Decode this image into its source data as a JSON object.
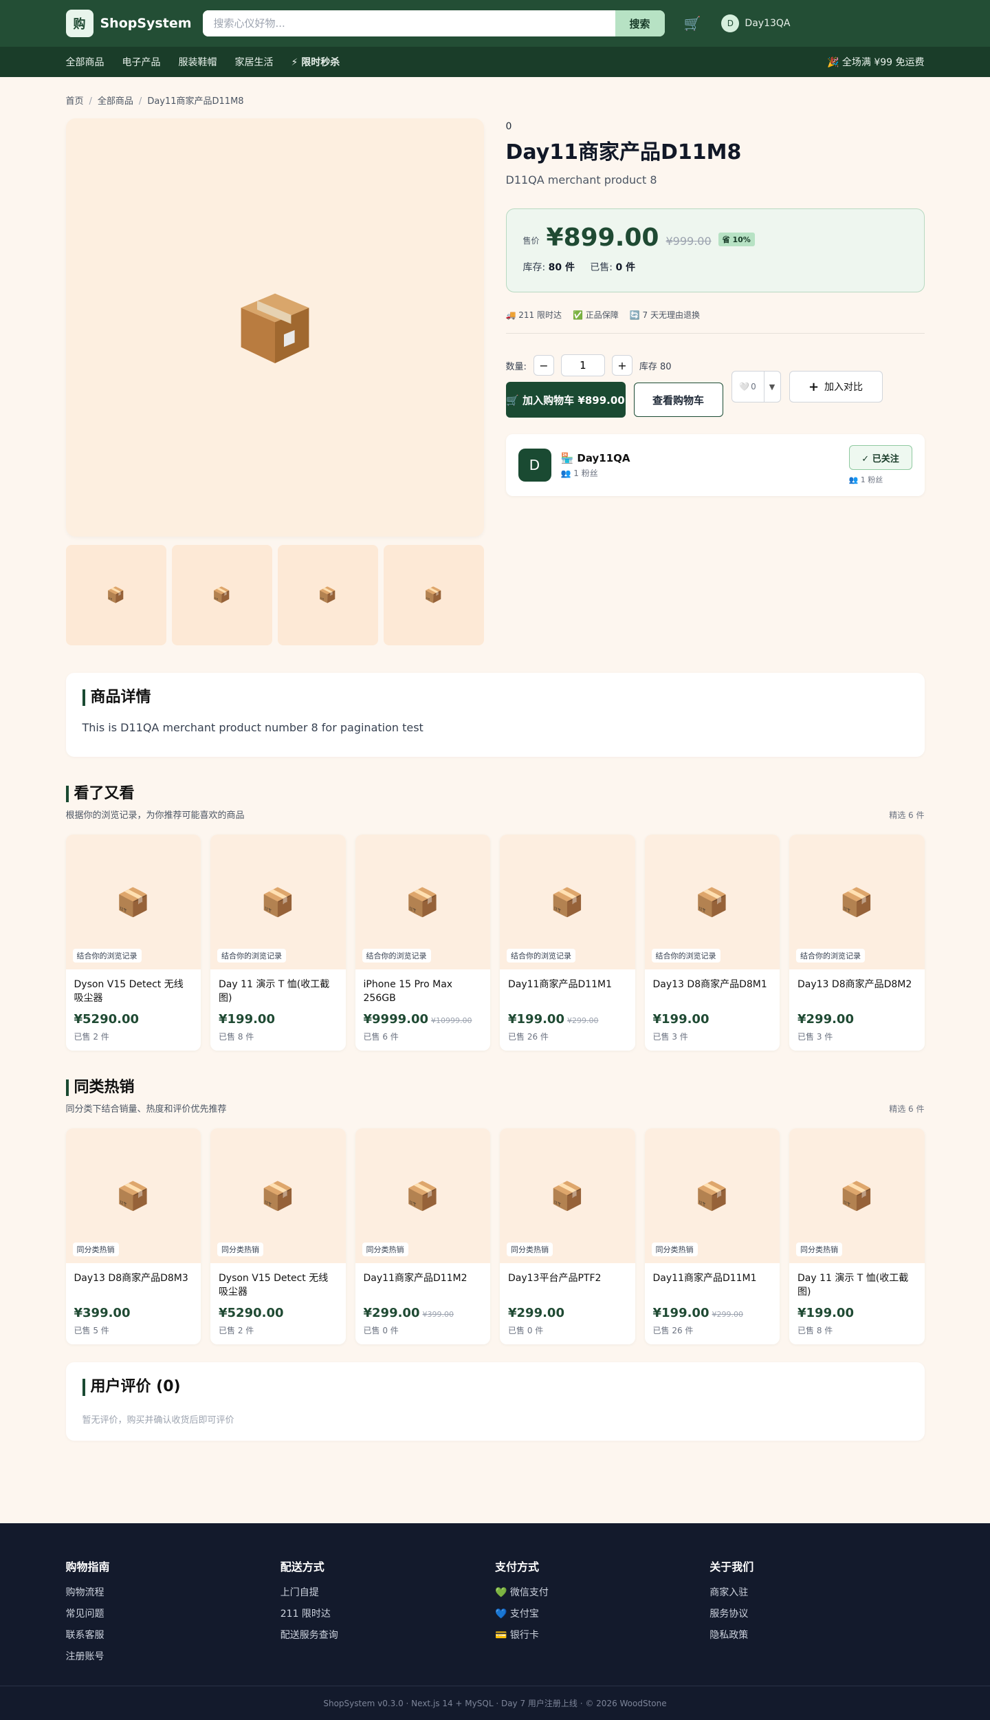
{
  "header": {
    "logo_char": "购",
    "brand": "ShopSystem",
    "search_placeholder": "搜索心仪好物...",
    "search_button": "搜索",
    "user_initial": "D",
    "user_name": "Day13QA"
  },
  "nav": {
    "items": [
      "全部商品",
      "电子产品",
      "服装鞋帽",
      "家居生活",
      "⚡ 限时秒杀"
    ],
    "promo": "🎉 全场满 ¥99 免运费"
  },
  "breadcrumb": [
    "首页",
    "全部商品",
    "Day11商家产品D11M8"
  ],
  "product": {
    "top_number": "0",
    "title": "Day11商家产品D11M8",
    "subtitle": "D11QA merchant product 8",
    "price_label": "售价",
    "price": "¥899.00",
    "old_price": "¥999.00",
    "discount": "省 10%",
    "stock_label": "库存:",
    "stock_value": "80 件",
    "sold_label": "已售:",
    "sold_value": "0 件",
    "guarantees": [
      "🚚 211 限时达",
      "✅ 正品保障",
      "🔄 7 天无理由退换"
    ],
    "qty_label": "数量:",
    "qty_value": "1",
    "qty_stock": "库存 80",
    "add_cart": "🛒 加入购物车 ¥899.00",
    "view_cart": "查看购物车",
    "fav_count": "0",
    "compare": "加入对比"
  },
  "shop": {
    "initial": "D",
    "name": "🏪 Day11QA",
    "fans": "👥 1 粉丝",
    "follow": "✓ 已关注",
    "fans2": "👥 1 粉丝"
  },
  "detail": {
    "title": "商品详情",
    "text": "This is D11QA merchant product number 8 for pagination test"
  },
  "recommend": {
    "title": "看了又看",
    "subtitle": "根据你的浏览记录，为你推荐可能喜欢的商品",
    "count": "精选 6 件",
    "items": [
      {
        "tag": "结合你的浏览记录",
        "name": "Dyson V15 Detect 无线吸尘器",
        "price": "¥5290.00",
        "old": "",
        "sold": "已售 2 件"
      },
      {
        "tag": "结合你的浏览记录",
        "name": "Day 11 演示 T 恤(收工截图)",
        "price": "¥199.00",
        "old": "",
        "sold": "已售 8 件"
      },
      {
        "tag": "结合你的浏览记录",
        "name": "iPhone 15 Pro Max 256GB",
        "price": "¥9999.00",
        "old": "¥10999.00",
        "sold": "已售 6 件"
      },
      {
        "tag": "结合你的浏览记录",
        "name": "Day11商家产品D11M1",
        "price": "¥199.00",
        "old": "¥299.00",
        "sold": "已售 26 件"
      },
      {
        "tag": "结合你的浏览记录",
        "name": "Day13 D8商家产品D8M1",
        "price": "¥199.00",
        "old": "",
        "sold": "已售 3 件"
      },
      {
        "tag": "结合你的浏览记录",
        "name": "Day13 D8商家产品D8M2",
        "price": "¥299.00",
        "old": "",
        "sold": "已售 3 件"
      }
    ]
  },
  "hot": {
    "title": "同类热销",
    "subtitle": "同分类下结合销量、热度和评价优先推荐",
    "count": "精选 6 件",
    "items": [
      {
        "tag": "同分类热销",
        "name": "Day13 D8商家产品D8M3",
        "price": "¥399.00",
        "old": "",
        "sold": "已售 5 件"
      },
      {
        "tag": "同分类热销",
        "name": "Dyson V15 Detect 无线吸尘器",
        "price": "¥5290.00",
        "old": "",
        "sold": "已售 2 件"
      },
      {
        "tag": "同分类热销",
        "name": "Day11商家产品D11M2",
        "price": "¥299.00",
        "old": "¥399.00",
        "sold": "已售 0 件"
      },
      {
        "tag": "同分类热销",
        "name": "Day13平台产品PTF2",
        "price": "¥299.00",
        "old": "",
        "sold": "已售 0 件"
      },
      {
        "tag": "同分类热销",
        "name": "Day11商家产品D11M1",
        "price": "¥199.00",
        "old": "¥299.00",
        "sold": "已售 26 件"
      },
      {
        "tag": "同分类热销",
        "name": "Day 11 演示 T 恤(收工截图)",
        "price": "¥199.00",
        "old": "",
        "sold": "已售 8 件"
      }
    ]
  },
  "reviews": {
    "title": "用户评价 (0)",
    "empty": "暂无评价，购买并确认收货后即可评价"
  },
  "footer": {
    "cols": [
      {
        "title": "购物指南",
        "links": [
          "购物流程",
          "常见问题",
          "联系客服",
          "注册账号"
        ]
      },
      {
        "title": "配送方式",
        "links": [
          "上门自提",
          "211 限时达",
          "配送服务查询"
        ]
      },
      {
        "title": "支付方式",
        "links": [
          "💚 微信支付",
          "💙 支付宝",
          "💳 银行卡"
        ]
      },
      {
        "title": "关于我们",
        "links": [
          "商家入驻",
          "服务协议",
          "隐私政策"
        ]
      }
    ],
    "copyright": "ShopSystem v0.3.0 · Next.js 14 + MySQL · Day 7 用户注册上线 · © 2026 WoodStone"
  },
  "colors": {
    "brand": "#234e35",
    "accent": "#1a4a32",
    "price": "#1f4a33",
    "footer": "#131a2c"
  }
}
